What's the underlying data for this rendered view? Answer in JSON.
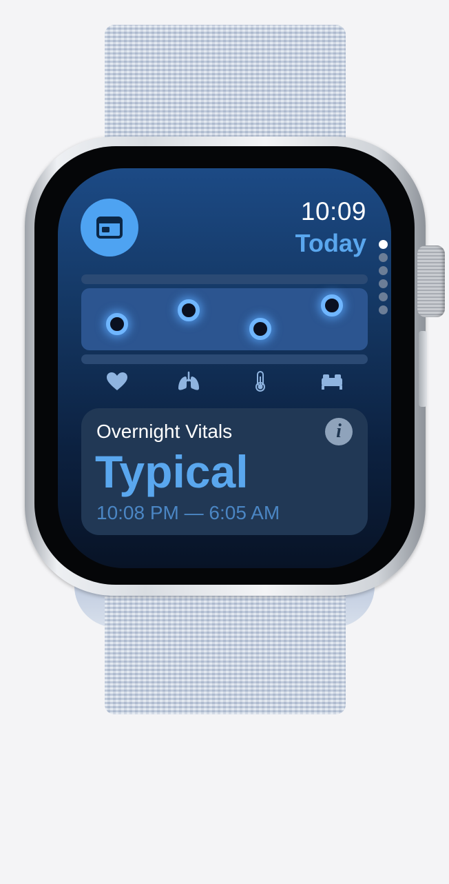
{
  "watch": {
    "time": "10:09",
    "date_label": "Today",
    "page_indicator": {
      "count": 6,
      "active_index": 0
    }
  },
  "chart_data": {
    "type": "scatter",
    "categories": [
      "heart-rate",
      "respiratory-rate",
      "wrist-temperature",
      "sleep"
    ],
    "values": [
      0.42,
      0.65,
      0.35,
      0.72
    ],
    "point_color": "#6fb6ff"
  },
  "vital_icons": [
    "heart-icon",
    "lungs-icon",
    "thermometer-icon",
    "bed-icon"
  ],
  "card": {
    "title": "Overnight Vitals",
    "status": "Typical",
    "time_range": "10:08 PM — 6:05 AM"
  },
  "colors": {
    "accent": "#5aa7ee",
    "app_button": "#4ea3f2",
    "card_bg": "#213855",
    "icon": "#8fb4e0"
  }
}
